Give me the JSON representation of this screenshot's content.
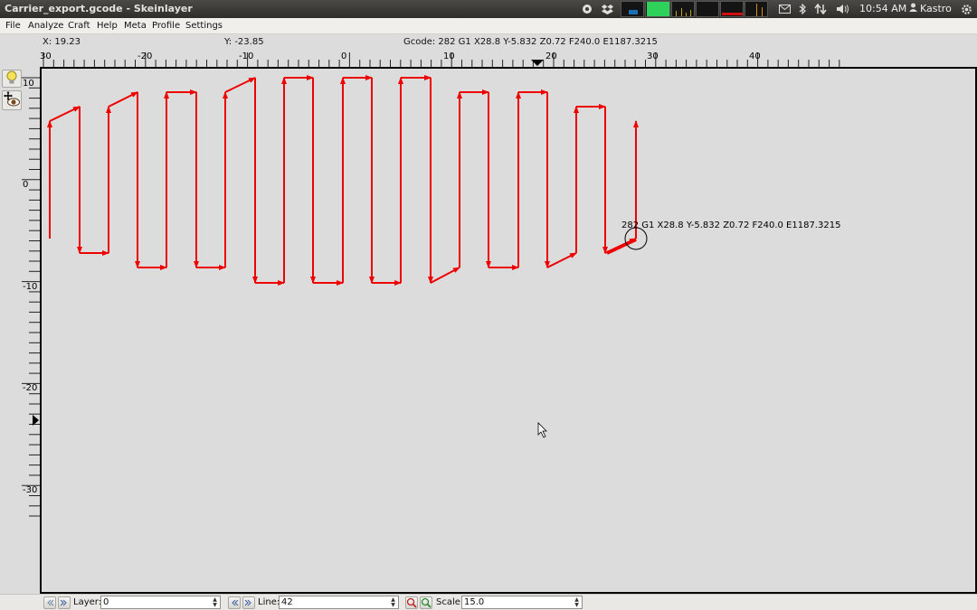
{
  "window": {
    "title": "Carrier_export.gcode - Skeinlayer"
  },
  "tray": {
    "clock": "10:54 AM",
    "user": "Kastro"
  },
  "menu": [
    {
      "label": "File"
    },
    {
      "label": "Analyze"
    },
    {
      "label": "Craft"
    },
    {
      "label": "Help"
    },
    {
      "label": "Meta"
    },
    {
      "label": "Profile"
    },
    {
      "label": "Settings"
    }
  ],
  "status": {
    "x": "X: 19.23",
    "y": "Y: -23.85",
    "gcode": "Gcode: 282 G1 X28.8 Y-5.832 Z0.72 F240.0 E1187.3215"
  },
  "canvas": {
    "annotation": "282 G1 X28.8 Y-5.832 Z0.72 F240.0 E1187.3215",
    "path_color": "#ee0000",
    "h_ticks": [
      "30",
      "-20",
      "-10",
      "0",
      "10",
      "20",
      "30",
      "40"
    ],
    "v_ticks": [
      "10",
      "0",
      "-10",
      "-20",
      "-30"
    ]
  },
  "bottom": {
    "layer_label": "Layer:",
    "layer_value": "0",
    "line_label": "Line:",
    "line_value": "42",
    "scale_label": "Scale:",
    "scale_value": "15.0"
  }
}
